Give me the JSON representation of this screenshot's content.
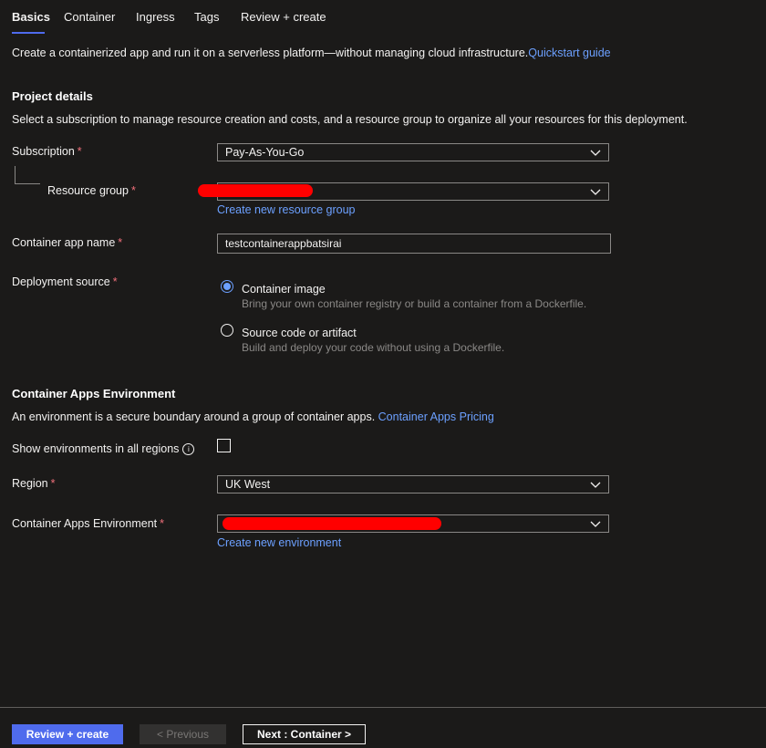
{
  "tabs": [
    "Basics",
    "Container",
    "Ingress",
    "Tags",
    "Review + create"
  ],
  "intro": {
    "text": "Create a containerized app and run it on a serverless platform—without managing cloud infrastructure.",
    "link": "Quickstart guide"
  },
  "project": {
    "title": "Project details",
    "description": "Select a subscription to manage resource creation and costs, and a resource group to organize all your resources for this deployment.",
    "subscription_label": "Subscription",
    "subscription_value": "Pay-As-You-Go",
    "resource_group_label": "Resource group",
    "resource_group_value": "",
    "create_resource_group_link": "Create new resource group",
    "app_name_label": "Container app name",
    "app_name_value": "testcontainerappbatsirai",
    "deployment_source_label": "Deployment source",
    "source_options": [
      {
        "label": "Container image",
        "hint": "Bring your own container registry or build a container from a Dockerfile.",
        "selected": true
      },
      {
        "label": "Source code or artifact",
        "hint": "Build and deploy your code without using a Dockerfile.",
        "selected": false
      }
    ]
  },
  "environment": {
    "title": "Container Apps Environment",
    "description": "An environment is a secure boundary around a group of container apps.",
    "pricing_link": "Container Apps Pricing",
    "show_all_regions_label": "Show environments in all regions",
    "show_all_regions_checked": false,
    "region_label": "Region",
    "region_value": "UK West",
    "env_label": "Container Apps Environment",
    "env_value": "",
    "create_env_link": "Create new environment"
  },
  "required_marker": "*",
  "footer": {
    "review_create": "Review + create",
    "previous": "< Previous",
    "next": "Next : Container >"
  },
  "colors": {
    "background": "#1b1a19",
    "accent": "#4f6bed",
    "link": "#6ca0ff",
    "required": "#f1707b",
    "redaction": "#ff0000"
  }
}
